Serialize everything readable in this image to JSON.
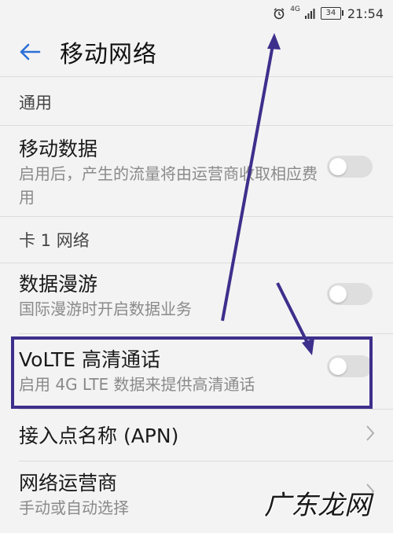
{
  "status_bar": {
    "network": "4G",
    "battery": "34",
    "time": "21:54",
    "icons": [
      "alarm-icon",
      "signal-icon",
      "battery-icon"
    ]
  },
  "header": {
    "title": "移动网络",
    "back_icon": "arrow-left-icon"
  },
  "sections": [
    {
      "header": "通用",
      "items": [
        {
          "title": "移动数据",
          "description": "启用后，产生的流量将由运营商收取相应费用",
          "control": "toggle",
          "checked": false
        }
      ]
    },
    {
      "header": "卡 1 网络",
      "items": [
        {
          "title": "数据漫游",
          "description": "国际漫游时开启数据业务",
          "control": "toggle",
          "checked": false
        },
        {
          "title": "VoLTE 高清通话",
          "description": "启用 4G LTE 数据来提供高清通话",
          "control": "toggle",
          "checked": false
        },
        {
          "title": "接入点名称 (APN)",
          "description": "",
          "control": "chevron"
        },
        {
          "title": "网络运营商",
          "description": "手动或自动选择",
          "control": "chevron"
        }
      ]
    }
  ],
  "watermark": "广东龙网",
  "colors": {
    "accent": "#2a6fd6",
    "annotation": "#3d2f8c",
    "toggle_off": "#dedede",
    "background": "#f3f3f3"
  }
}
